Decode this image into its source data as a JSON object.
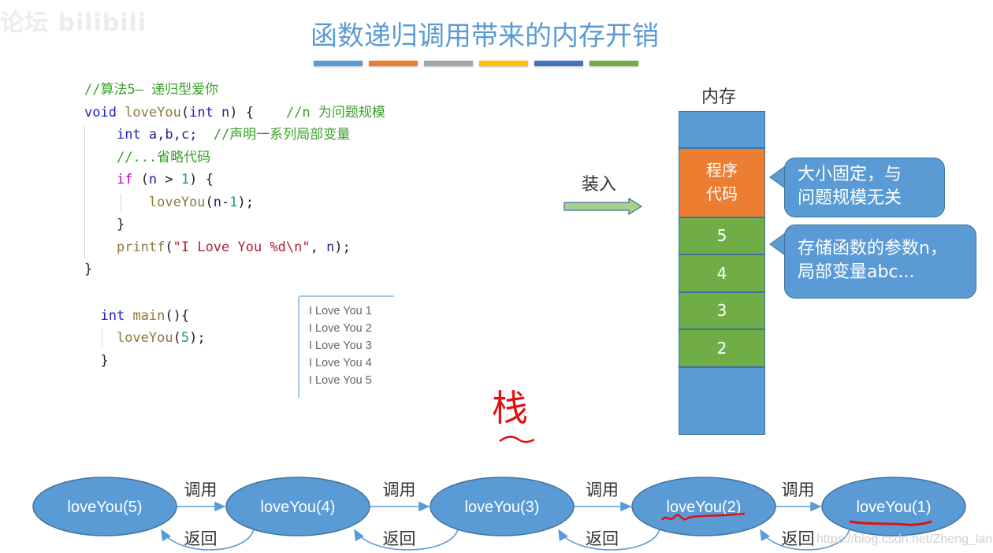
{
  "watermark": "论坛 bilibili",
  "title": "函数递归调用带来的内存开销",
  "color_bars": [
    "#5b9bd5",
    "#ed7d31",
    "#a5a5a5",
    "#ffc000",
    "#4472c4",
    "#70ad47"
  ],
  "code": {
    "comment_title": "//算法5— 递归型爱你",
    "l2_void": "void ",
    "l2_fn": "loveYou",
    "l2_open": "(",
    "l2_int": "int",
    "l2_n": " n",
    "l2_close": ") {    ",
    "l2_comment": "//n 为问题规模",
    "l3_indent": "    ",
    "l3_int": "int",
    "l3_vars": " a,b,c;  ",
    "l3_comment": "//声明一系列局部变量",
    "l4_indent": "    ",
    "l4_comment": "//...省略代码",
    "l5_indent": "    ",
    "l5_if": "if",
    "l5_p1": " (",
    "l5_n": "n",
    "l5_gt": " > ",
    "l5_num": "1",
    "l5_p2": ") {",
    "l6_indent": "        ",
    "l6_fn": "loveYou",
    "l6_p1": "(",
    "l6_n": "n",
    "l6_minus": "-",
    "l6_num": "1",
    "l6_p2": ");",
    "l7": "    }",
    "l8_indent": "    ",
    "l8_fn": "printf",
    "l8_p1": "(",
    "l8_str": "\"I Love You %d\\n\"",
    "l8_comma": ", ",
    "l8_n": "n",
    "l8_p2": ");",
    "l9": "}",
    "m1_indent": "  ",
    "m1_int": "int",
    "m1_fn": " main",
    "m1_rest": "(){",
    "m2_indent": "    ",
    "m2_fn": "loveYou",
    "m2_p1": "(",
    "m2_num": "5",
    "m2_p2": ");",
    "m3": "  }"
  },
  "output_lines": [
    "I Love You 1",
    "I Love You 2",
    "I Love You 3",
    "I Love You 4",
    "I Love You 5"
  ],
  "load_label": "装入",
  "memory": {
    "title": "内存",
    "code_cell_line1": "程序",
    "code_cell_line2": "代码",
    "stack_frames": [
      "5",
      "4",
      "3",
      "2"
    ]
  },
  "callouts": {
    "code_line1": "大小固定，与",
    "code_line2": "问题规模无关",
    "stack_line1": "存储函数的参数n，",
    "stack_line2": "局部变量abc..."
  },
  "annotation": "栈",
  "call_chain": {
    "nodes": [
      "loveYou(5)",
      "loveYou(4)",
      "loveYou(3)",
      "loveYou(2)",
      "loveYou(1)"
    ],
    "call_label": "调用",
    "return_label": "返回"
  },
  "source_url": "https://blog.csdn.net/Zheng_lan"
}
